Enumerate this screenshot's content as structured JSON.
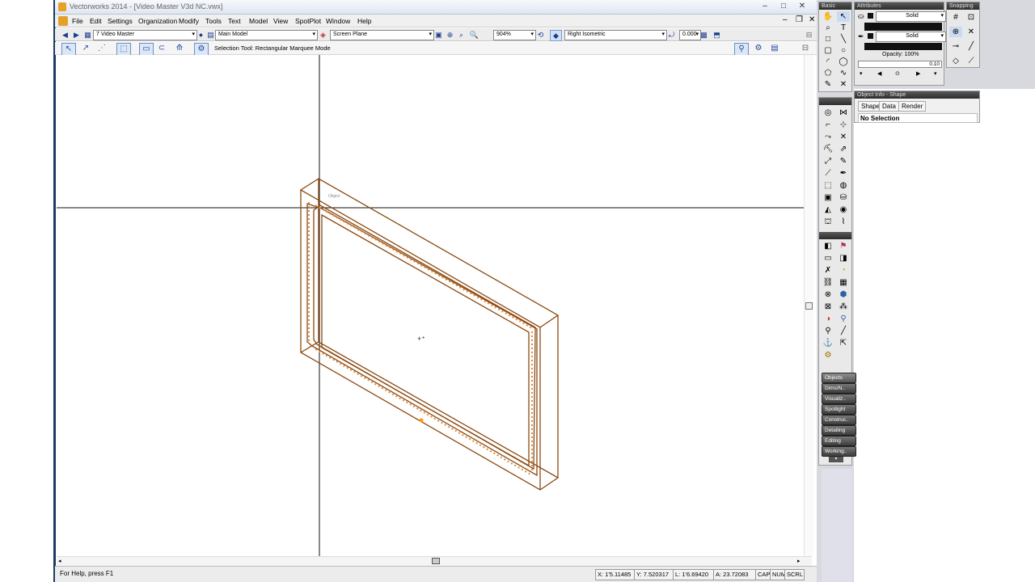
{
  "titlebar": {
    "title": "Vectorworks 2014 - [Video Master V3d NC.vwx]",
    "controls": [
      "–",
      "□",
      "✕"
    ]
  },
  "menubar": {
    "items": [
      "File",
      "Edit",
      "Settings",
      "Organization",
      "Modify",
      "Tools",
      "Text",
      "Model",
      "View",
      "SpotPlot",
      "Window",
      "Help"
    ]
  },
  "viewbar": {
    "class_value": "7 Video Master",
    "layer_value": "Main Model",
    "plane_value": "Screen Plane",
    "zoom_value": "904%",
    "view_value": "Right Isometric",
    "rotation_value": "0.000",
    "back_icon": "arrow-left-icon",
    "forward_icon": "arrow-right-icon"
  },
  "modebar": {
    "mode_text": "Selection Tool: Rectangular Marquee Mode"
  },
  "drawing": {
    "object_label": "Object",
    "colors": {
      "object": "#8b4a12",
      "highlight": "#e08a3c",
      "crosshair": "#111111",
      "orange_dot": "#ff9900"
    }
  },
  "status": {
    "help_text": "For Help, press F1",
    "x": "X: 1'5.11485",
    "y": "Y: 7.520317",
    "l": "L: 1'6.69420",
    "a": "A: 23.72083",
    "indicators": [
      "CAP",
      "NUM",
      "SCRL"
    ]
  },
  "basic_palette": {
    "title": "Basic",
    "tools": [
      "hand-icon",
      "arrow-icon",
      "magnifier-icon",
      "text-icon",
      "rectangle-icon",
      "line-icon",
      "rounded-rect-icon",
      "circle-icon",
      "arc-icon",
      "oval-icon",
      "polygon-icon",
      "freehand-icon",
      "eyedropper-icon",
      "x-icon"
    ]
  },
  "attributes_palette": {
    "title": "Attributes",
    "fill_style": "Solid",
    "pen_style": "Solid",
    "opacity": "Opacity: 100%",
    "line_weight": "0.10"
  },
  "snapping_palette": {
    "title": "Snapping"
  },
  "object_info": {
    "title": "Object Info - Shape",
    "tabs": [
      "Shape",
      "Data",
      "Render"
    ],
    "selection": "No Selection"
  },
  "tool_sets": {
    "categories": [
      "Objects",
      "Dims/N..",
      "Visualiz..",
      "Spotlight",
      "Construc..",
      "Detailing",
      "Editing",
      "Working.."
    ]
  }
}
